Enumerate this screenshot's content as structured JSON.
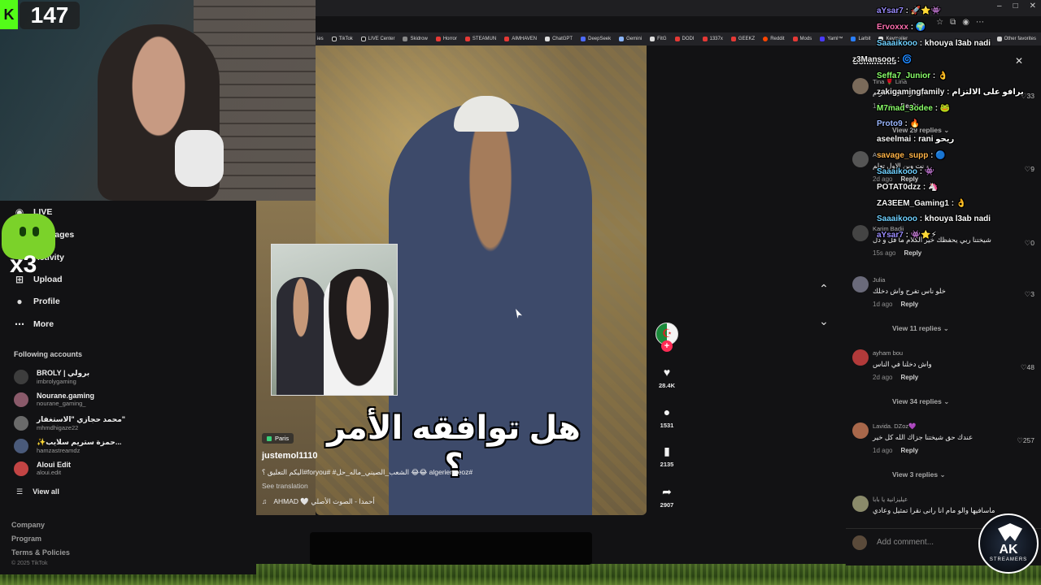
{
  "stream": {
    "viewer_count": "147",
    "kick_letter": "K",
    "combo": "x3"
  },
  "browser": {
    "window_controls": [
      "–",
      "□",
      "✕"
    ],
    "bookmarks": [
      "ies",
      "TikTok",
      "LIVE Center",
      "Skidrow",
      "Horror",
      "STEAMUN",
      "AIMHAVEN",
      "ChatGPT",
      "DeepSeek",
      "Gemini",
      "FitG",
      "DODI",
      "1337x",
      "GEEKZ",
      "Reddit",
      "Mods",
      "Yaml™",
      "Larbit",
      "Keymailer"
    ],
    "other_favorites": "Other favorites"
  },
  "sidebar": {
    "nav": [
      {
        "label": "LIVE",
        "icon": "live-icon"
      },
      {
        "label": "Messages",
        "icon": "message-icon"
      },
      {
        "label": "Activity",
        "icon": "bell-icon"
      },
      {
        "label": "Upload",
        "icon": "upload-icon"
      },
      {
        "label": "Profile",
        "icon": "profile-icon"
      },
      {
        "label": "More",
        "icon": "more-icon"
      }
    ],
    "following_title": "Following accounts",
    "accounts": [
      {
        "name": "BROLY | برولي",
        "handle": "imbrolygaming"
      },
      {
        "name": "Nourane.gaming",
        "handle": "nourane_gaming_"
      },
      {
        "name": "محمد حجازي \"الاستغفار\"",
        "handle": "mhmdhigaze22"
      },
      {
        "name": "✨حمزة ستريم سلايب...",
        "handle": "hamzastreamdz"
      },
      {
        "name": "Aloui Edit",
        "handle": "aloui.edit"
      }
    ],
    "view_all": "View all",
    "footer": [
      "Company",
      "Program",
      "Terms & Policies"
    ],
    "copyright": "© 2025 TikTok"
  },
  "video": {
    "caption_ar": "هل توافقه الأمر ؟",
    "location": "Paris",
    "author": "justemol1110",
    "description": "#algerienneoz 😂😂 الشعب_الصيني_ماله_حل# #foryou#اليكم التعليق ؟",
    "see_translation": "See translation",
    "sound": "AHMAD 🤍 أحمدا - الصوت الأصلي"
  },
  "actions": {
    "likes": "28.4K",
    "comments": "1531",
    "saves": "2135",
    "shares": "2907"
  },
  "comments_panel": {
    "title": "Comments",
    "items": [
      {
        "user": "Tina 🌹 Lina",
        "text": "برافو على الالتزام",
        "meta": "1d ago",
        "likes": "33"
      },
      {
        "user": "Asaad",
        "text": "و نت وين الاول تعلم",
        "meta": "2d ago",
        "likes": "9"
      },
      {
        "user": "Karim Badji",
        "text": "شيختنا ربي يحفظك خير الكلام ما قل و دل",
        "meta": "15s ago",
        "likes": "0"
      },
      {
        "user": "Julia",
        "text": "خلو ناس تفرح واش دخلك",
        "meta": "1d ago",
        "likes": "3"
      },
      {
        "user": "ayham bou",
        "text": "واش دخلنا في الناس",
        "meta": "2d ago",
        "likes": "48"
      },
      {
        "user": "Lavida. DZoz💜",
        "text": "عندك حق شيختنا جزاك الله كل خير",
        "meta": "1d ago",
        "likes": "257"
      },
      {
        "user": "عيليزانية يا بابا",
        "text": "ماسافيها والو مام انا رانى نقرا تمثيل وعادي",
        "meta": "",
        "likes": ""
      }
    ],
    "reply_label": "Reply",
    "view_replies": [
      "View 29 replies",
      "View 11 replies",
      "View 34 replies",
      "View 3 replies"
    ],
    "add_comment_placeholder": "Add comment..."
  },
  "chat": [
    {
      "user": "aYsar7",
      "msg": "🚀⭐👾",
      "color": "#9b8cff"
    },
    {
      "user": "Ervoxxx",
      "msg": "🌍",
      "color": "#ff6fb0"
    },
    {
      "user": "Saaaikooo",
      "msg": "khouya l3ab nadi",
      "color": "#6fd0ff"
    },
    {
      "user": "z3Mansoor",
      "msg": "🌀",
      "color": "#f2f2f2"
    },
    {
      "user": "Seffa7_Junior",
      "msg": "👌",
      "color": "#8aff6a"
    },
    {
      "user": "zakigamingfamily",
      "msg": "",
      "color": "#f2f2f2"
    },
    {
      "user": "M7mad_3odee",
      "msg": "🐸",
      "color": "#8aff6a"
    },
    {
      "user": "Proto9",
      "msg": "🔥",
      "color": "#9bb7ff"
    },
    {
      "user": "aseelmai",
      "msg": "rani ريحو",
      "color": "#f2f2f2"
    },
    {
      "user": "savage_supp",
      "msg": "🔵",
      "color": "#ffb347"
    },
    {
      "user": "Saaaikooo",
      "msg": "👾",
      "color": "#6fd0ff"
    },
    {
      "user": "POTAT0dzz",
      "msg": "🦄",
      "color": "#f2f2f2"
    },
    {
      "user": "ZA3EEM_Gaming1",
      "msg": "👌",
      "color": "#f2f2f2"
    },
    {
      "user": "Saaaikooo",
      "msg": "khouya l3ab nadi",
      "color": "#6fd0ff"
    },
    {
      "user": "aYsar7",
      "msg": "👾⭐⚡",
      "color": "#9b8cff"
    }
  ],
  "logo": {
    "title": "AK",
    "subtitle": "STREAMERS"
  }
}
